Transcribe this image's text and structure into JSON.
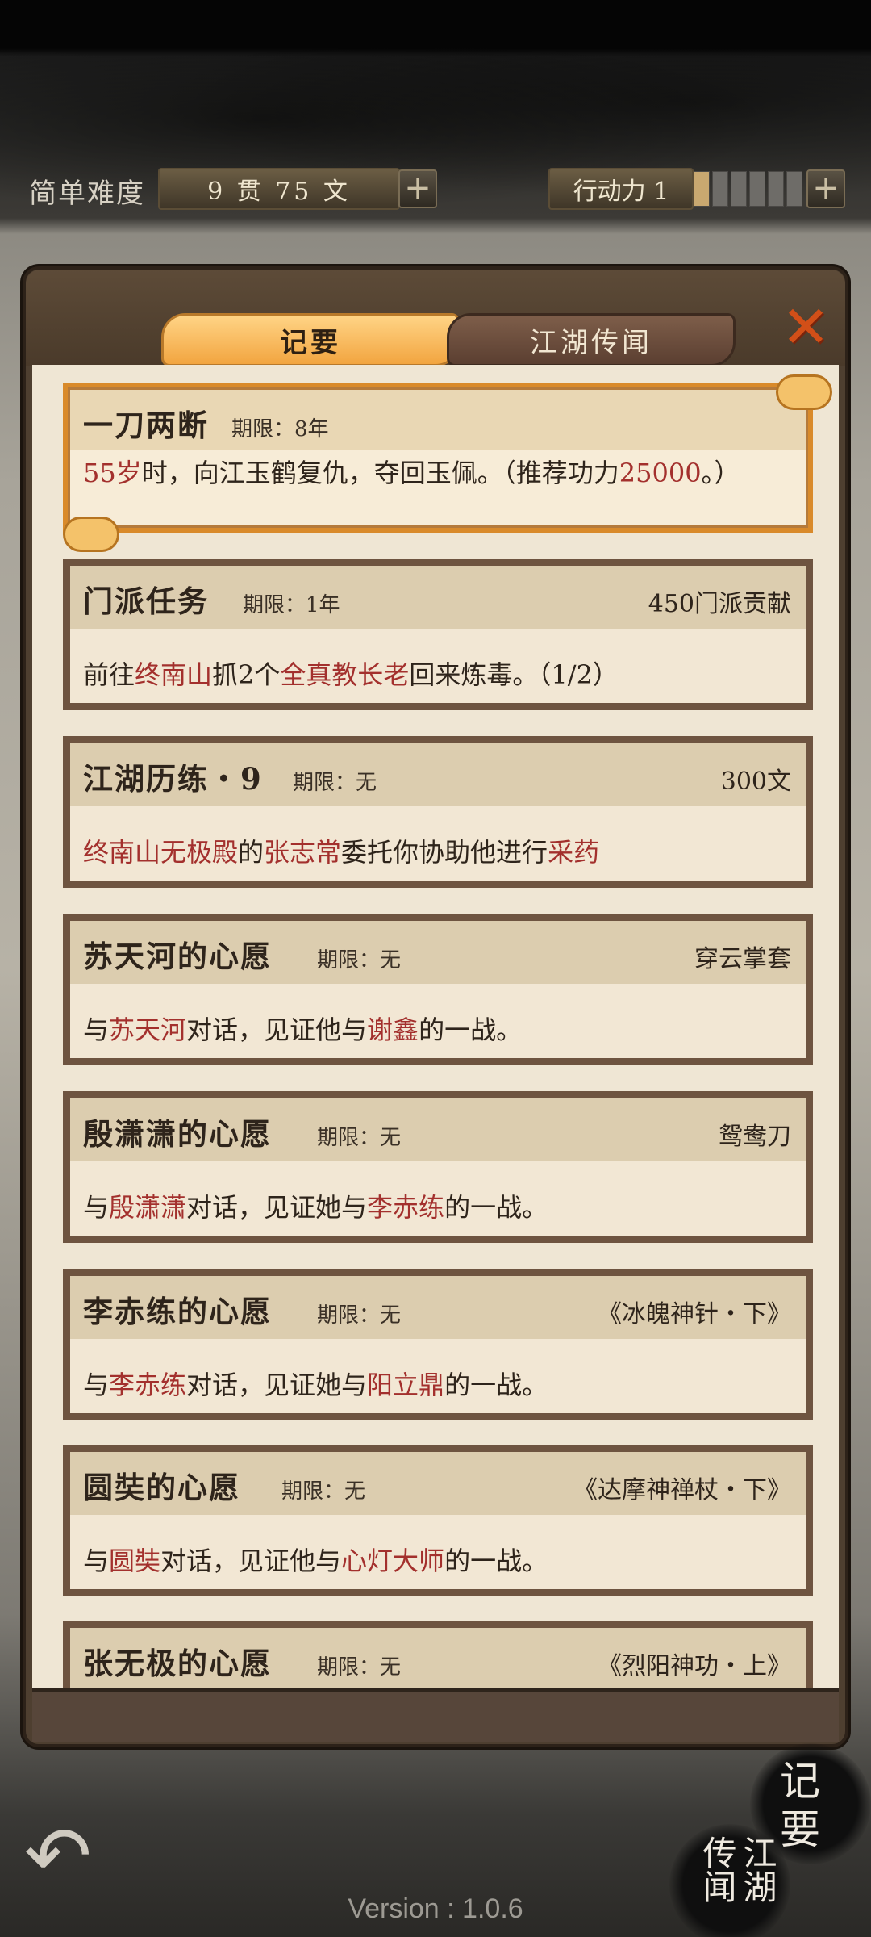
{
  "topbar": {
    "difficulty": "简单难度",
    "money": "9 贯 75 文",
    "action_power": "行动力 1",
    "action_power_value": 1,
    "action_power_max": 6
  },
  "tabs": [
    {
      "label": "记要",
      "active": true
    },
    {
      "label": "江湖传闻",
      "active": false
    }
  ],
  "quests": [
    {
      "title": "一刀两断",
      "limit": "期限：8年",
      "reward": "",
      "featured": true,
      "desc": [
        {
          "t": "55岁",
          "hl": true
        },
        {
          "t": "时，向江玉鹤复仇，夺回玉佩。（推荐功力",
          "hl": false
        },
        {
          "t": "25000",
          "hl": true
        },
        {
          "t": "。）",
          "hl": false
        }
      ]
    },
    {
      "title": "门派任务",
      "limit": "期限：1年",
      "reward": "450门派贡献",
      "desc": [
        {
          "t": "前往",
          "hl": false
        },
        {
          "t": "终南山",
          "hl": true
        },
        {
          "t": "抓2个",
          "hl": false
        },
        {
          "t": "全真教长老",
          "hl": true
        },
        {
          "t": "回来炼毒。（1/2）",
          "hl": false
        }
      ]
    },
    {
      "title": "江湖历练・9",
      "limit": "期限：无",
      "reward": "300文",
      "desc": [
        {
          "t": "终南山无极殿",
          "hl": true
        },
        {
          "t": "的",
          "hl": false
        },
        {
          "t": "张志常",
          "hl": true
        },
        {
          "t": "委托你协助他进行",
          "hl": false
        },
        {
          "t": "采药",
          "hl": true
        }
      ]
    },
    {
      "title": "苏天河的心愿",
      "limit": "期限：无",
      "reward": "穿云掌套",
      "desc": [
        {
          "t": "与",
          "hl": false
        },
        {
          "t": "苏天河",
          "hl": true
        },
        {
          "t": "对话，见证他与",
          "hl": false
        },
        {
          "t": "谢鑫",
          "hl": true
        },
        {
          "t": "的一战。",
          "hl": false
        }
      ]
    },
    {
      "title": "殷潇潇的心愿",
      "limit": "期限：无",
      "reward": "鸳鸯刀",
      "desc": [
        {
          "t": "与",
          "hl": false
        },
        {
          "t": "殷潇潇",
          "hl": true
        },
        {
          "t": "对话，见证她与",
          "hl": false
        },
        {
          "t": "李赤练",
          "hl": true
        },
        {
          "t": "的一战。",
          "hl": false
        }
      ]
    },
    {
      "title": "李赤练的心愿",
      "limit": "期限：无",
      "reward": "《冰魄神针・下》",
      "desc": [
        {
          "t": "与",
          "hl": false
        },
        {
          "t": "李赤练",
          "hl": true
        },
        {
          "t": "对话，见证她与",
          "hl": false
        },
        {
          "t": "阳立鼎",
          "hl": true
        },
        {
          "t": "的一战。",
          "hl": false
        }
      ]
    },
    {
      "title": "圆奘的心愿",
      "limit": "期限：无",
      "reward": "《达摩神禅杖・下》",
      "desc": [
        {
          "t": "与",
          "hl": false
        },
        {
          "t": "圆奘",
          "hl": true
        },
        {
          "t": "对话，见证他与",
          "hl": false
        },
        {
          "t": "心灯大师",
          "hl": true
        },
        {
          "t": "的一战。",
          "hl": false
        }
      ]
    },
    {
      "title": "张无极的心愿",
      "limit": "期限：无",
      "reward": "《烈阳神功・上》",
      "desc": []
    }
  ],
  "side_buttons": {
    "memo": "记要",
    "news": "江湖传闻"
  },
  "version": "Version : 1.0.6",
  "colors": {
    "highlight": "#a3302d",
    "tab_active": "#f2a540",
    "panel_frame": "#6e5440",
    "close_icon": "#d24f18"
  }
}
